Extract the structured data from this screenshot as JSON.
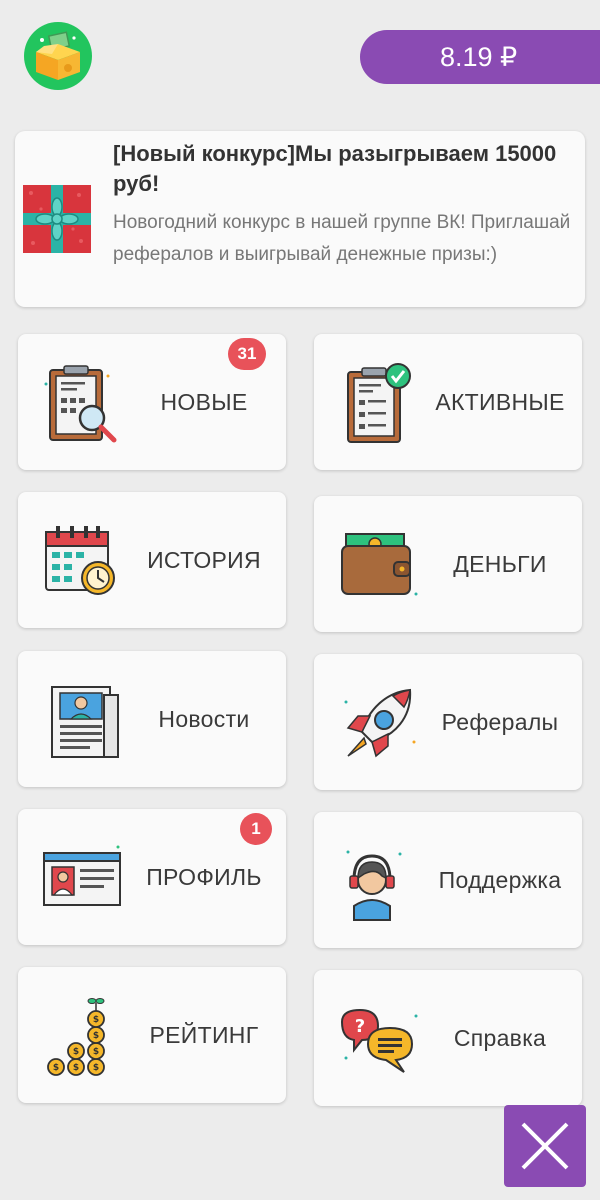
{
  "header": {
    "logo_icon": "treasure-box-icon",
    "balance": "8.19 ₽",
    "accent_color": "#8a4bb3"
  },
  "promo": {
    "icon": "gift-icon",
    "title": "[Новый конкурс]Мы разыгрываем 15000 руб!",
    "text": "Новогодний конкурс в нашей группе ВК! Приглашай рефералов и выигрывай денежные призы:)"
  },
  "menu": [
    {
      "label": "НОВЫЕ",
      "icon": "clipboard-search-icon",
      "badge": "31"
    },
    {
      "label": "АКТИВНЫЕ",
      "icon": "clipboard-check-icon"
    },
    {
      "label": "ИСТОРИЯ",
      "icon": "calendar-clock-icon"
    },
    {
      "label": "ДЕНЬГИ",
      "icon": "wallet-icon"
    },
    {
      "label": "Новости",
      "icon": "newspaper-icon"
    },
    {
      "label": "Рефералы",
      "icon": "rocket-icon"
    },
    {
      "label": "ПРОФИЛЬ",
      "icon": "id-card-icon",
      "badge": "1"
    },
    {
      "label": "Поддержка",
      "icon": "support-agent-icon"
    },
    {
      "label": "РЕЙТИНГ",
      "icon": "coins-stack-icon"
    },
    {
      "label": "Справка",
      "icon": "chat-help-icon"
    }
  ],
  "close_icon": "close-icon"
}
